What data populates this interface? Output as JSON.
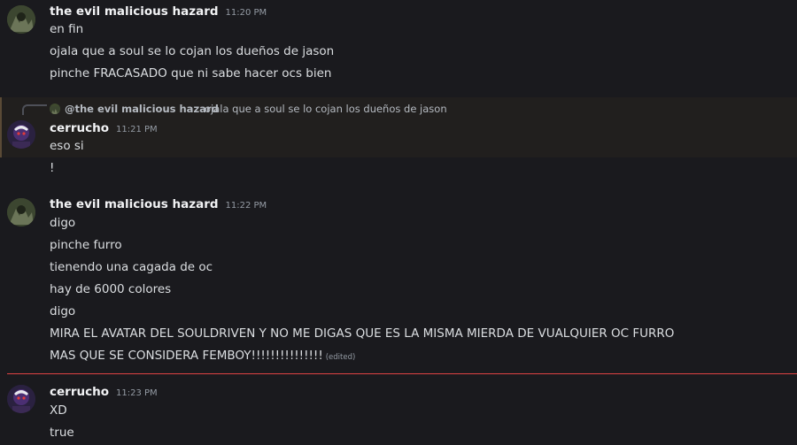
{
  "messages": {
    "g1": {
      "author": "the evil malicious hazard",
      "time": "11:20 PM",
      "lines": [
        "en fin",
        "ojala que a soul se lo cojan los dueños de jason",
        "pinche FRACASADO que ni sabe hacer ocs bien"
      ]
    },
    "reply": {
      "author": "@the evil malicious hazard",
      "text": "ojala que a soul se lo cojan los dueños de jason"
    },
    "g2": {
      "author": "cerrucho",
      "time": "11:21 PM",
      "lines": [
        "eso si",
        "!"
      ]
    },
    "g3": {
      "author": "the evil malicious hazard",
      "time": "11:22 PM",
      "lines": [
        "digo",
        "pinche furro",
        "tienendo una cagada de oc",
        "hay de 6000 colores",
        "digo",
        "MIRA EL AVATAR DEL SOULDRIVEN Y NO ME DIGAS QUE ES LA MISMA MIERDA DE VUALQUIER OC FURRO",
        "MAS QUE SE CONSIDERA FEMBOY!!!!!!!!!!!!!!!"
      ],
      "edited": "(edited)"
    },
    "g4": {
      "author": "cerrucho",
      "time": "11:23 PM",
      "lines": [
        "XD",
        "true"
      ]
    }
  },
  "colors": {
    "background": "#1a1a1e",
    "reply_highlight": "#211f1e",
    "new_divider": "#e04343"
  }
}
